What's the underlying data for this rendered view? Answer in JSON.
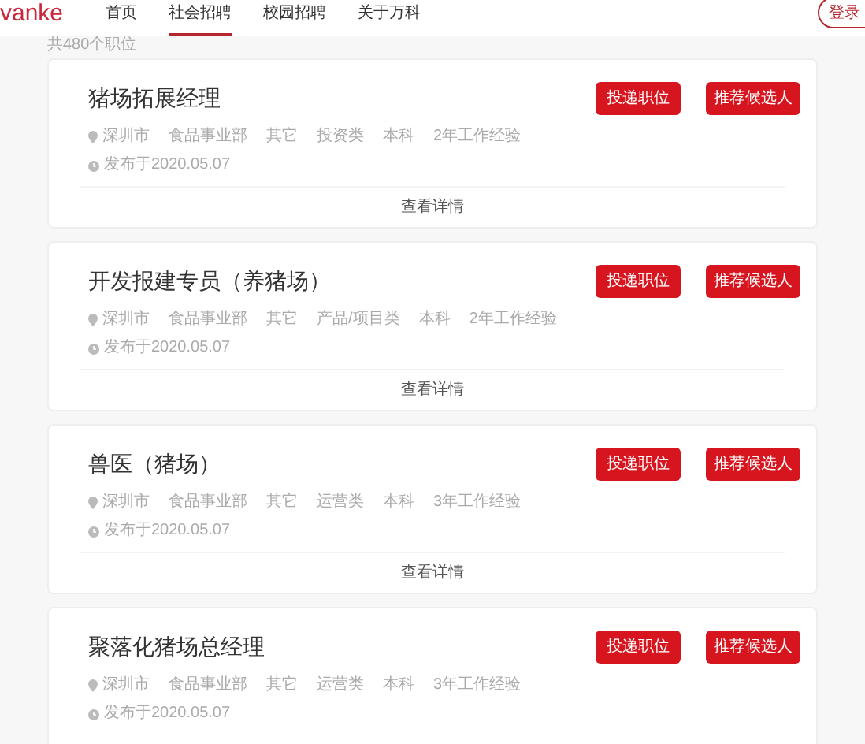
{
  "logo": "vanke",
  "nav": [
    {
      "label": "首页",
      "selected": false
    },
    {
      "label": "社会招聘",
      "selected": true
    },
    {
      "label": "校园招聘",
      "selected": false
    },
    {
      "label": "关于万科",
      "selected": false
    }
  ],
  "login_button": "登录",
  "total": "共480个职位",
  "jobs": [
    {
      "title": "猪场拓展经理",
      "city": "深圳市",
      "tags": [
        "食品事业部",
        "其它",
        "投资类",
        "本科",
        "2年工作经验"
      ],
      "posted": "发布于2020.05.07",
      "apply": "投递职位",
      "recommend": "推荐候选人",
      "details": "查看详情"
    },
    {
      "title": "开发报建专员（养猪场）",
      "city": "深圳市",
      "tags": [
        "食品事业部",
        "其它",
        "产品/项目类",
        "本科",
        "2年工作经验"
      ],
      "posted": "发布于2020.05.07",
      "apply": "投递职位",
      "recommend": "推荐候选人",
      "details": "查看详情"
    },
    {
      "title": "兽医（猪场）",
      "city": "深圳市",
      "tags": [
        "食品事业部",
        "其它",
        "运营类",
        "本科",
        "3年工作经验"
      ],
      "posted": "发布于2020.05.07",
      "apply": "投递职位",
      "recommend": "推荐候选人",
      "details": "查看详情"
    },
    {
      "title": "聚落化猪场总经理",
      "city": "深圳市",
      "tags": [
        "食品事业部",
        "其它",
        "运营类",
        "本科",
        "3年工作经验"
      ],
      "posted": "发布于2020.05.07",
      "apply": "投递职位",
      "recommend": "推荐候选人"
    }
  ]
}
